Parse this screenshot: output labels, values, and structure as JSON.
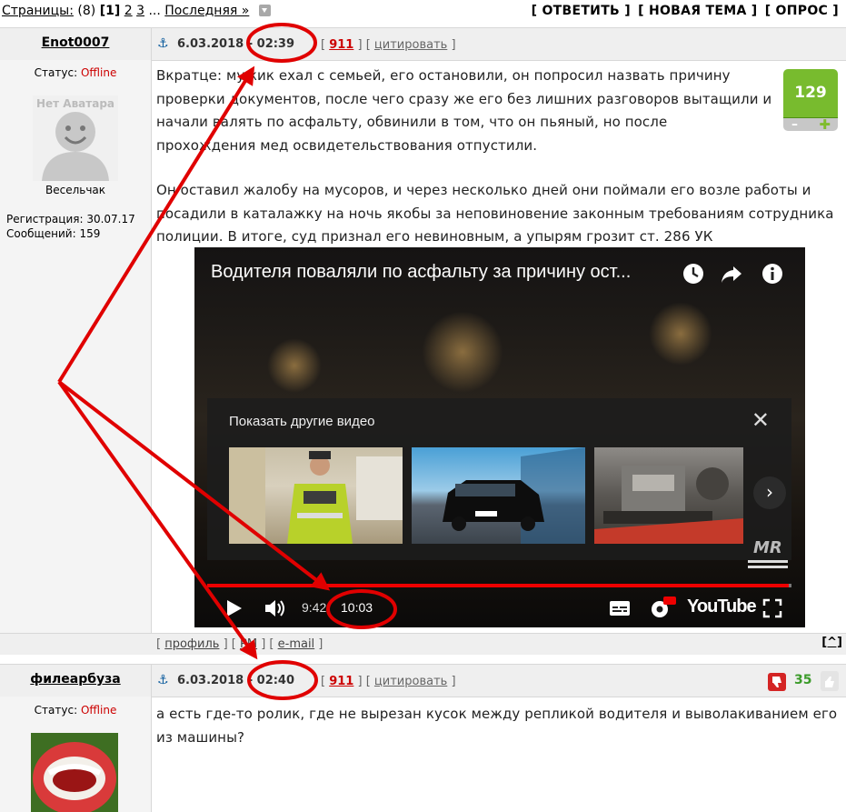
{
  "pagination": {
    "label": "Страницы:",
    "count": "(8)",
    "current": "[1]",
    "page2": "2",
    "page3": "3",
    "ellipsis": "...",
    "last": "Последняя »"
  },
  "actions": {
    "reply": "[ ОТВЕТИТЬ ]",
    "new_topic": "[ НОВАЯ ТЕМА ]",
    "poll": "[ ОПРОС ]"
  },
  "post1": {
    "author": "Enot0007",
    "date": "6.03.2018 - 02:39",
    "meta_open": "[",
    "meta_mid": "] [",
    "meta_close": "]",
    "number": "911",
    "cite": "цитировать",
    "status_label": "Статус:",
    "status": "Offline",
    "avatar_text": "Нет Аватара",
    "rank": "Весельчак",
    "registration": "Регистрация: 30.07.17",
    "messages": "Сообщений: 159",
    "rating": "129",
    "para1_l1": "Вкратце: мужик ехал с семьей, его остановили, он попросил назвать причину",
    "para1_l2": "проверки документов, после чего сразу же его без лишних разговоров вытащили и",
    "para1_l3": "начали валять по асфальту, обвинили в том, что он пьяный, но после",
    "para1_l4": "прохождения мед освидетельствования отпустили.",
    "para2_l1": "Он оставил жалобу на мусоров, и через несколько дней они поймали его возле работы и",
    "para2_l2": "посадили в каталажку на ночь якобы за неповиновение законным требованиям сотрудника",
    "para2_l3": "полиции. В итоге, суд признал его невиновным, а упырям грозит ст. 286 УК",
    "footer_profile": "профиль",
    "footer_pm": "PM",
    "footer_email": "e-mail",
    "to_top": "[^]"
  },
  "video": {
    "title": "Водителя поваляли по асфальту за причину ост...",
    "suggest_title": "Показать другие видео",
    "time_current": "9:42",
    "time_total": "10:03",
    "brand": "YouTube",
    "watermark": "MR",
    "progress": 0.995
  },
  "post2": {
    "author": "филеарбуза",
    "date": "6.03.2018 - 02:40",
    "meta_open": "[",
    "meta_mid": "] [",
    "meta_close": "]",
    "number": "911",
    "cite": "цитировать",
    "status_label": "Статус:",
    "status": "Offline",
    "rating": "35",
    "text_l1": "а есть где-то ролик, где не вырезан кусок между репликой водителя и выволакиванием его",
    "text_l2": "из машины?"
  },
  "colors": {
    "annotation": "#e00000",
    "rating_green": "#78bb2e",
    "offline": "#cc0000"
  }
}
